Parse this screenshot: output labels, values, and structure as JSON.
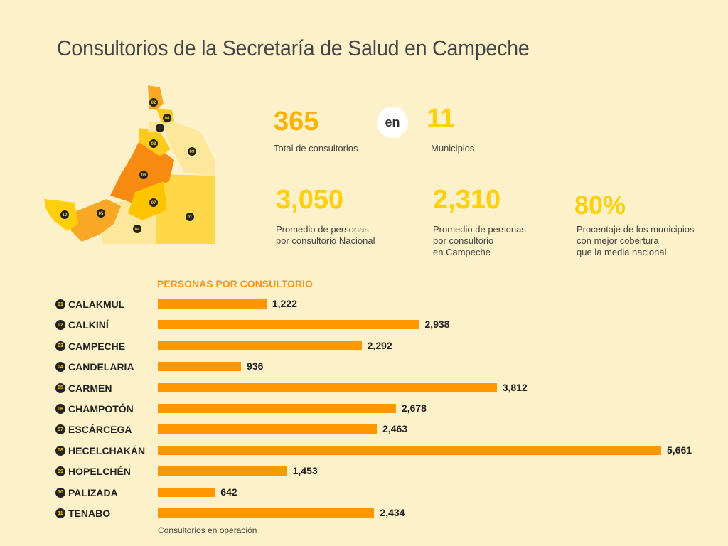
{
  "title": "Consultorios de la Secretaría de Salud en Campeche",
  "stats": {
    "total_value": "365",
    "total_label": "Total de consultorios",
    "connector": "en",
    "municipios_value": "11",
    "municipios_label": "Municipios",
    "nacional_value": "3,050",
    "nacional_label_1": "Promedio de personas",
    "nacional_label_2": "por consultorio Nacional",
    "campeche_value": "2,310",
    "campeche_label_1": "Promedio de personas",
    "campeche_label_2": "por consultorio",
    "campeche_label_3": "en Campeche",
    "cobertura_value": "80%",
    "cobertura_label_1": "Procentaje de los municipios",
    "cobertura_label_2": "con mejor cobertura",
    "cobertura_label_3": "que la media nacional"
  },
  "map_labels": [
    "01",
    "02",
    "03",
    "04",
    "05",
    "06",
    "07",
    "08",
    "09",
    "10",
    "11"
  ],
  "colors": {
    "background": "#fcf1c8",
    "bar": "#ff9800",
    "accent_yellow": "#ffcf0a",
    "accent_orange": "#f7941d"
  },
  "chart_data": {
    "type": "bar",
    "orientation": "horizontal",
    "title": "PERSONAS POR CONSULTORIO",
    "footer": "Consultorios en operación",
    "codes": [
      "01",
      "02",
      "03",
      "04",
      "05",
      "06",
      "07",
      "08",
      "09",
      "10",
      "11"
    ],
    "categories": [
      "CALAKMUL",
      "CALKINÍ",
      "CAMPECHE",
      "CANDELARIA",
      "CARMEN",
      "CHAMPOTÓN",
      "ESCÁRCEGA",
      "HECELCHAKÁN",
      "HOPELCHÉN",
      "PALIZADA",
      "TENABO"
    ],
    "values": [
      1222,
      2938,
      2292,
      936,
      3812,
      2678,
      2463,
      5661,
      1453,
      642,
      2434
    ],
    "value_labels": [
      "1,222",
      "2,938",
      "2,292",
      "936",
      "3,812",
      "2,678",
      "2,463",
      "5,661",
      "1,453",
      "642",
      "2,434"
    ],
    "xlim": [
      0,
      5661
    ]
  }
}
